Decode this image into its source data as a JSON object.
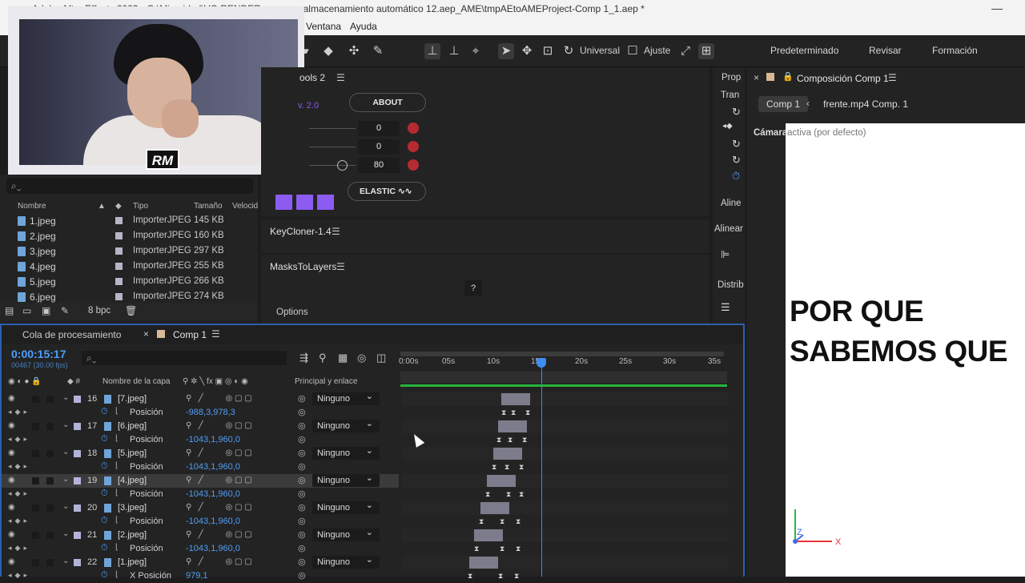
{
  "window": {
    "title": "Adobe After Effects 2023 - G:\\Mi unidad\\VG RENDER ... nueva almacenamiento automático 12.aep_AME\\tmpAEtoAMEProject-Comp 1_1.aep *"
  },
  "menu": {
    "items": [
      "Ventana",
      "Ayuda"
    ]
  },
  "toolbar": {
    "universal": "Universal",
    "ajuste": "Ajuste"
  },
  "workspaces": [
    "Predeterminado",
    "Revisar",
    "Formación"
  ],
  "webcam": {
    "badge": "RM"
  },
  "project": {
    "headers": {
      "name": "Nombre",
      "type": "Tipo",
      "size": "Tamaño",
      "speed": "Velocid"
    },
    "files": [
      {
        "name": "1.jpeg",
        "type": "ImporterJPEG",
        "size": "145 KB"
      },
      {
        "name": "2.jpeg",
        "type": "ImporterJPEG",
        "size": "160 KB"
      },
      {
        "name": "3.jpeg",
        "type": "ImporterJPEG",
        "size": "297 KB"
      },
      {
        "name": "4.jpeg",
        "type": "ImporterJPEG",
        "size": "255 KB"
      },
      {
        "name": "5.jpeg",
        "type": "ImporterJPEG",
        "size": "266 KB"
      },
      {
        "name": "6.jpeg",
        "type": "ImporterJPEG",
        "size": "274 KB"
      }
    ],
    "bpc": "8 bpc"
  },
  "plugin": {
    "title": "ools 2",
    "version": "v. 2.0",
    "about": "ABOUT",
    "values": [
      "0",
      "0",
      "80"
    ],
    "elastic": "ELASTIC"
  },
  "keycloner": {
    "title": "KeyCloner-1.4"
  },
  "masks": {
    "title": "MasksToLayers",
    "help": "?",
    "options": "Options"
  },
  "props": {
    "labels": [
      "Prop",
      "Tran",
      "Aline",
      "Alinear",
      "Distrib"
    ]
  },
  "comp": {
    "tab": "Composición Comp 1",
    "crumb_active": "Comp 1",
    "crumb_next": "frente.mp4 Comp. 1",
    "camera_label": "Cámara",
    "camera_value": "activa (por defecto)",
    "text_line1": "POR QUE",
    "text_line2": "SABEMOS QUE",
    "axes": {
      "x": "X",
      "y": "Y",
      "z": "Z"
    }
  },
  "timeline": {
    "tab_queue": "Cola de procesamiento",
    "tab_comp": "Comp 1",
    "timecode": "0:00:15:17",
    "timecode_sub": "00467 (30.00 fps)",
    "col_name": "Nombre de la capa",
    "col_parent": "Principal y enlace",
    "ruler": [
      "0:00s",
      "05s",
      "10s",
      "15s",
      "20s",
      "25s",
      "30s",
      "35s"
    ],
    "layers": [
      {
        "num": "16",
        "name": "[7.jpeg]",
        "parent": "Ninguno",
        "prop": "Posición",
        "value": "-988,3,978,3"
      },
      {
        "num": "17",
        "name": "[6.jpeg]",
        "parent": "Ninguno",
        "prop": "Posición",
        "value": "-1043,1,960,0"
      },
      {
        "num": "18",
        "name": "[5.jpeg]",
        "parent": "Ninguno",
        "prop": "Posición",
        "value": "-1043,1,960,0"
      },
      {
        "num": "19",
        "name": "[4.jpeg]",
        "parent": "Ninguno",
        "prop": "Posición",
        "value": "-1043,1,960,0"
      },
      {
        "num": "20",
        "name": "[3.jpeg]",
        "parent": "Ninguno",
        "prop": "Posición",
        "value": "-1043,1,960,0"
      },
      {
        "num": "21",
        "name": "[2.jpeg]",
        "parent": "Ninguno",
        "prop": "Posición",
        "value": "-1043,1,960,0"
      },
      {
        "num": "22",
        "name": "[1.jpeg]",
        "parent": "Ninguno",
        "prop": "X Posición",
        "value": "979,1"
      }
    ]
  },
  "colors": {
    "accent": "#3e8df0",
    "timecode": "#4a9fff",
    "value_blue": "#4f9ef7",
    "plugin_purple": "#8c5cf2"
  }
}
